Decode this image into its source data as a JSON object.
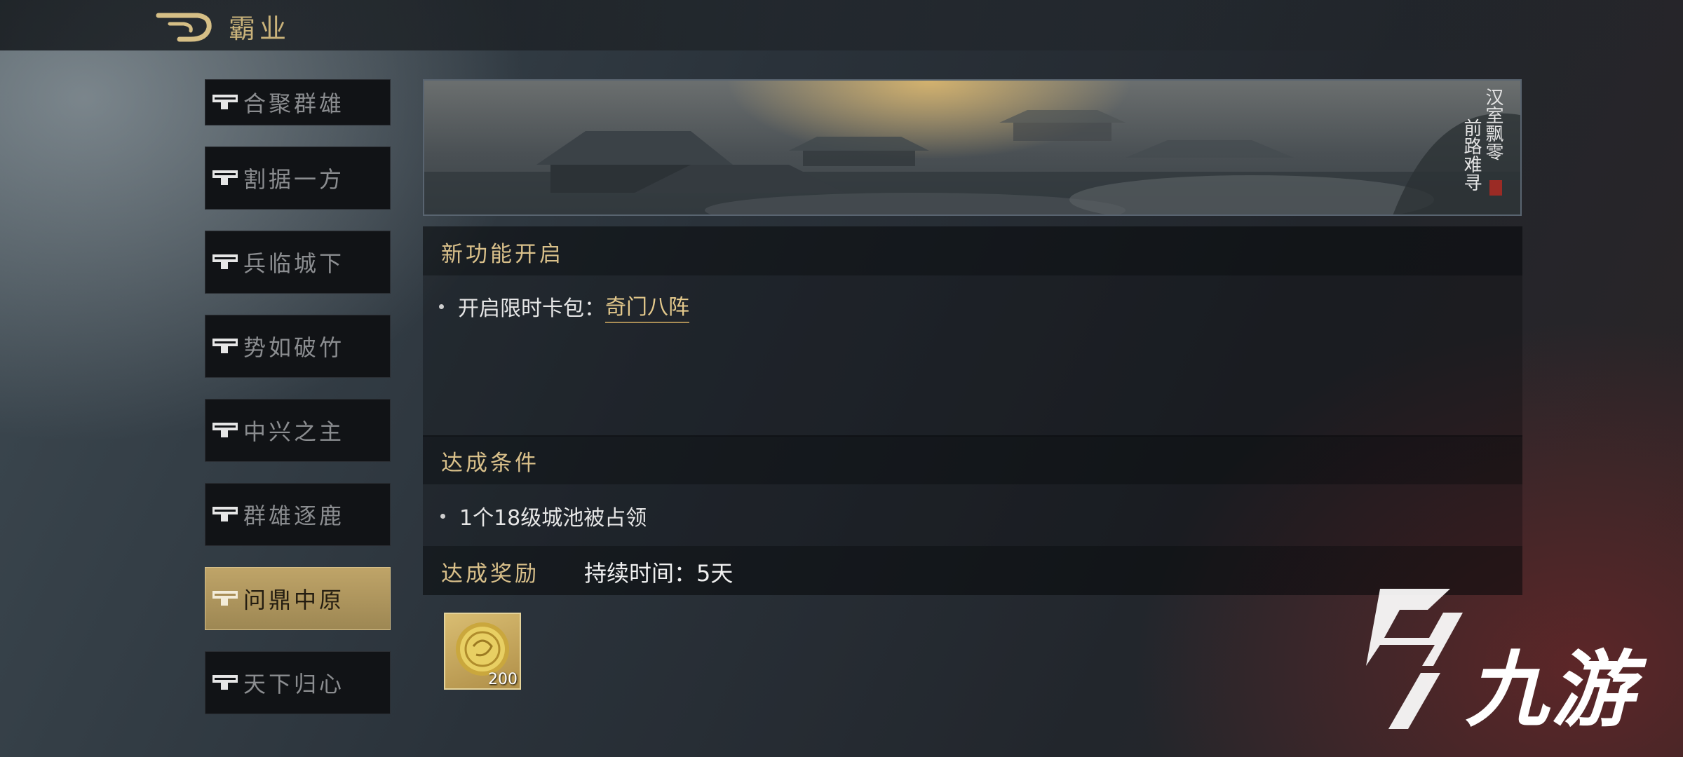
{
  "header": {
    "title": "霸业"
  },
  "sidebar": {
    "items": [
      {
        "label": "合聚群雄"
      },
      {
        "label": "割据一方"
      },
      {
        "label": "兵临城下"
      },
      {
        "label": "势如破竹"
      },
      {
        "label": "中兴之主"
      },
      {
        "label": "群雄逐鹿"
      },
      {
        "label": "问鼎中原",
        "active": true
      },
      {
        "label": "天下归心"
      }
    ]
  },
  "banner": {
    "line1": "汉室飘零",
    "line2": "前路难寻"
  },
  "new_feature": {
    "title": "新功能开启",
    "prefix": "开启限时卡包：",
    "link": "奇门八阵"
  },
  "conditions": {
    "title": "达成条件",
    "item": "1个18级城池被占领"
  },
  "rewards": {
    "title": "达成奖励",
    "duration": "持续时间：5天",
    "item_icon": "gold-coin-icon",
    "item_count": "200"
  },
  "watermark": {
    "text": "九游"
  },
  "colors": {
    "gold_text": "#d9c08a",
    "active_tab": "#bfa468",
    "panel_dark": "#111316"
  }
}
